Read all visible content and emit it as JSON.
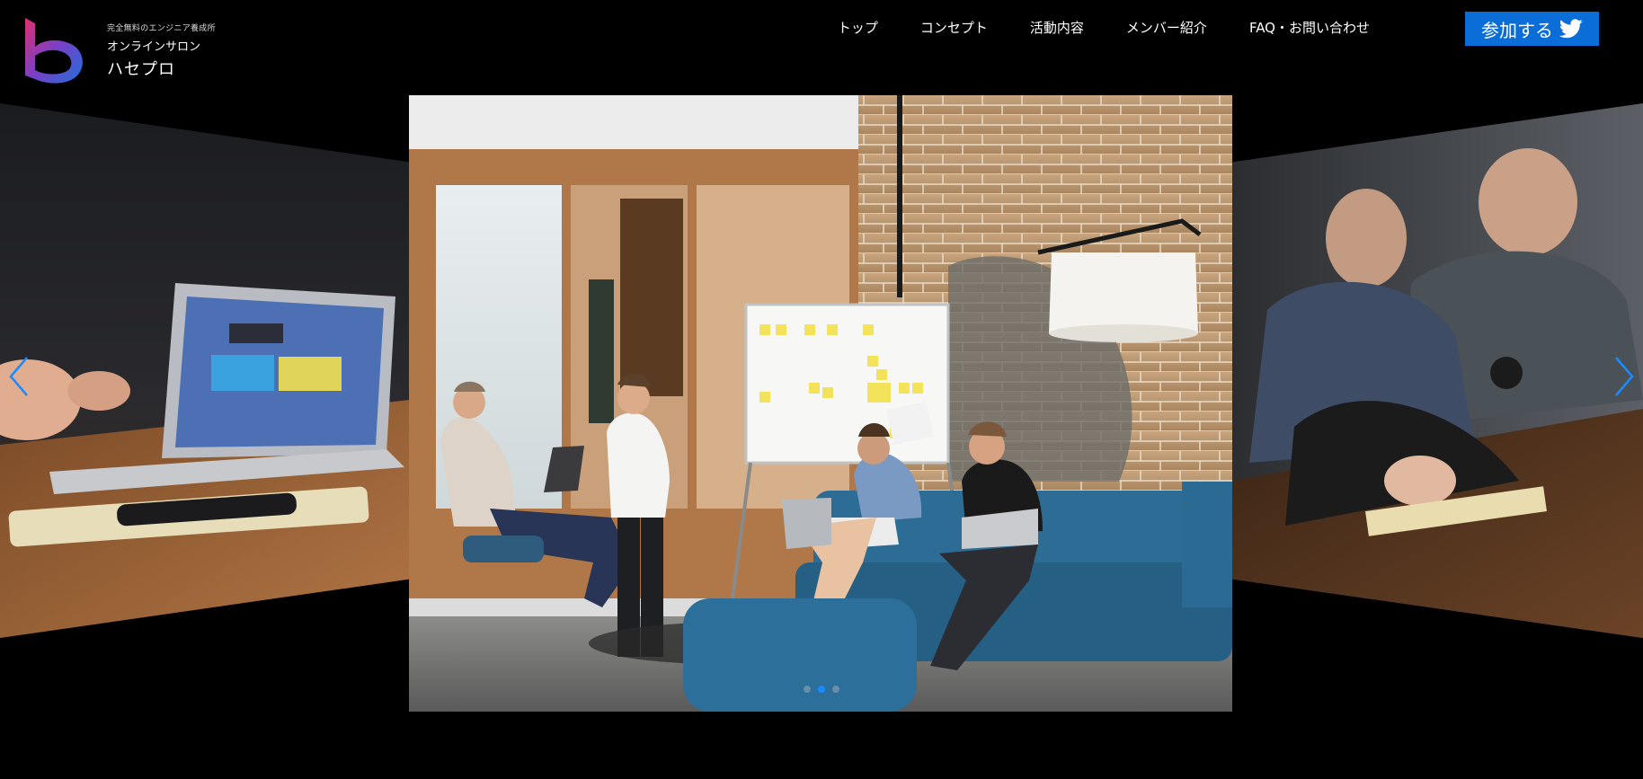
{
  "header": {
    "tagline": "完全無料のエンジニア養成所",
    "subtitle": "オンラインサロン",
    "site_name": "ハセプロ",
    "logo_icon": "h-logo-icon"
  },
  "nav": {
    "items": [
      {
        "label": "トップ"
      },
      {
        "label": "コンセプト"
      },
      {
        "label": "活動内容"
      },
      {
        "label": "メンバー紹介"
      },
      {
        "label": "FAQ・お問い合わせ"
      }
    ]
  },
  "cta": {
    "label": "参加する",
    "icon": "twitter-bird-icon",
    "color": "#0b6ed8"
  },
  "carousel": {
    "slide_count": 3,
    "active_index": 1,
    "prev_icon": "chevron-left-icon",
    "next_icon": "chevron-right-icon",
    "accent_color": "#1a8bff"
  }
}
